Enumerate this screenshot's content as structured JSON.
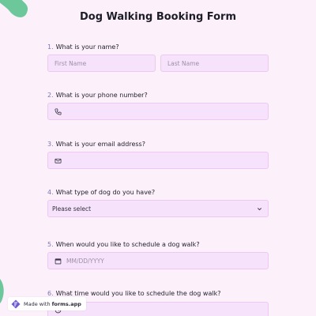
{
  "form": {
    "title": "Dog Walking Booking Form"
  },
  "questions": [
    {
      "num": "1.",
      "label": "What is your name?"
    },
    {
      "num": "2.",
      "label": "What is your phone number?"
    },
    {
      "num": "3.",
      "label": "What is your email address?"
    },
    {
      "num": "4.",
      "label": "What type of dog do you have?"
    },
    {
      "num": "5.",
      "label": "When would you like to schedule a dog walk?"
    },
    {
      "num": "6.",
      "label": "What time would you like to schedule the dog walk?"
    }
  ],
  "fields": {
    "first_name_placeholder": "First Name",
    "last_name_placeholder": "Last Name",
    "phone_icon": "phone-icon",
    "email_icon": "mail-icon",
    "dog_type_value": "Please select",
    "date_placeholder": "MM/DD/YYYY",
    "date_icon": "calendar-icon",
    "time_icon": "clock-icon"
  },
  "badge": {
    "prefix": "Made with",
    "brand": "forms.app"
  },
  "colors": {
    "background": "#fcf1fb",
    "field_bg": "#f6e3fb",
    "field_border": "#ecc8f2",
    "number_accent": "#7a76b0",
    "blob_green": "#6cc79a",
    "blob_blue": "#4c7de0",
    "brand_logo": "#6d5bd0"
  }
}
